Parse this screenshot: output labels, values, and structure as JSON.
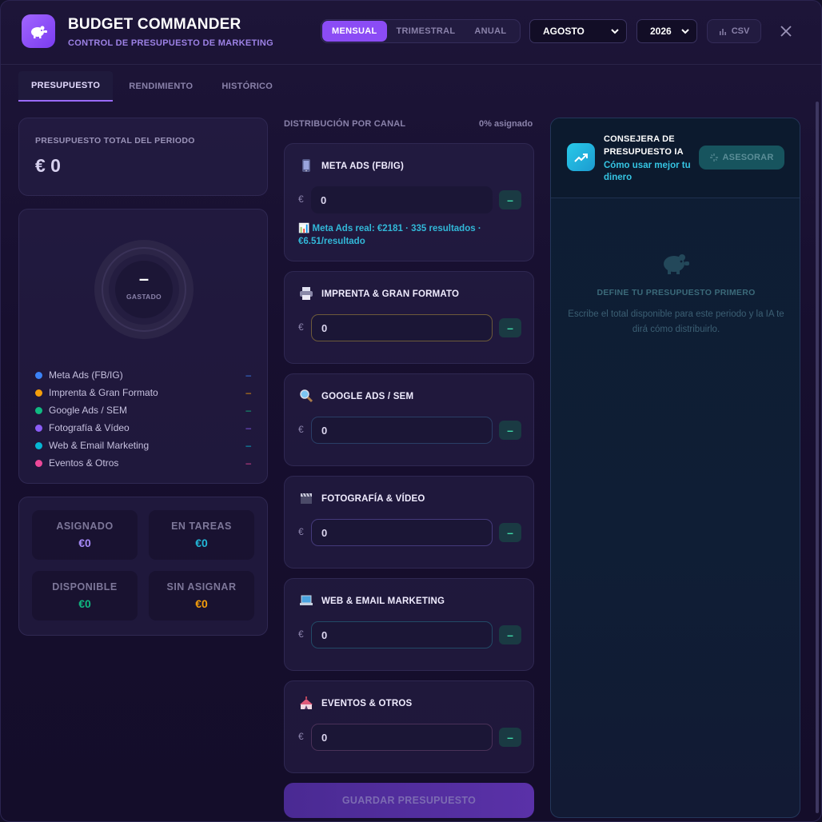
{
  "app": {
    "title": "BUDGET COMMANDER",
    "subtitle": "CONTROL DE PRESUPUESTO DE MARKETING"
  },
  "header": {
    "periods": [
      "MENSUAL",
      "TRIMESTRAL",
      "ANUAL"
    ],
    "active_period": "MENSUAL",
    "month": "AGOSTO",
    "year": "2026",
    "csv_label": "CSV"
  },
  "tabs": [
    {
      "label": "PRESUPUESTO",
      "active": true
    },
    {
      "label": "RENDIMIENTO",
      "active": false
    },
    {
      "label": "HISTÓRICO",
      "active": false
    }
  ],
  "total": {
    "label": "PRESUPUESTO TOTAL DEL PERIODO",
    "value": "€ 0"
  },
  "donut": {
    "center_value": "–",
    "center_label": "GASTADO"
  },
  "legend": [
    {
      "label": "Meta Ads (FB/IG)",
      "value": "–",
      "color": "#3b82f6"
    },
    {
      "label": "Imprenta & Gran Formato",
      "value": "–",
      "color": "#f59e0b"
    },
    {
      "label": "Google Ads / SEM",
      "value": "–",
      "color": "#10b981"
    },
    {
      "label": "Fotografía & Vídeo",
      "value": "–",
      "color": "#8b5cf6"
    },
    {
      "label": "Web & Email Marketing",
      "value": "–",
      "color": "#06b6d4"
    },
    {
      "label": "Eventos & Otros",
      "value": "–",
      "color": "#ec4899"
    }
  ],
  "stats": {
    "assigned": {
      "label": "ASIGNADO",
      "value": "€0",
      "color": "#a78bfa"
    },
    "in_tasks": {
      "label": "EN TAREAS",
      "value": "€0",
      "color": "#22b8d8"
    },
    "available": {
      "label": "DISPONIBLE",
      "value": "€0",
      "color": "#10b981"
    },
    "unassigned": {
      "label": "SIN ASIGNAR",
      "value": "€0",
      "color": "#f59e0b"
    }
  },
  "distribution": {
    "title": "DISTRIBUCIÓN POR CANAL",
    "pct": "0% asignado",
    "currency": "€",
    "minus": "–",
    "channels": [
      {
        "name": "META ADS (FB/IG)",
        "icon": "mobile-phone-icon",
        "value": "0",
        "note": "📊 Meta Ads real: €2181 · 335 resultados · €6.51/resultado"
      },
      {
        "name": "IMPRENTA & GRAN FORMATO",
        "icon": "printer-icon",
        "value": "0"
      },
      {
        "name": "GOOGLE ADS / SEM",
        "icon": "magnifier-icon",
        "value": "0"
      },
      {
        "name": "FOTOGRAFÍA & VÍDEO",
        "icon": "clapperboard-icon",
        "value": "0"
      },
      {
        "name": "WEB & EMAIL MARKETING",
        "icon": "laptop-icon",
        "value": "0"
      },
      {
        "name": "EVENTOS & OTROS",
        "icon": "circus-tent-icon",
        "value": "0"
      }
    ]
  },
  "save_label": "GUARDAR PRESUPUESTO",
  "advisor": {
    "title": "CONSEJERA DE PRESUPUESTO IA",
    "subtitle": "Cómo usar mejor tu dinero",
    "button": "ASESORAR",
    "empty_title": "DEFINE TU PRESUPUESTO PRIMERO",
    "empty_text": "Escribe el total disponible para este periodo y la IA te dirá cómo distribuirlo."
  }
}
